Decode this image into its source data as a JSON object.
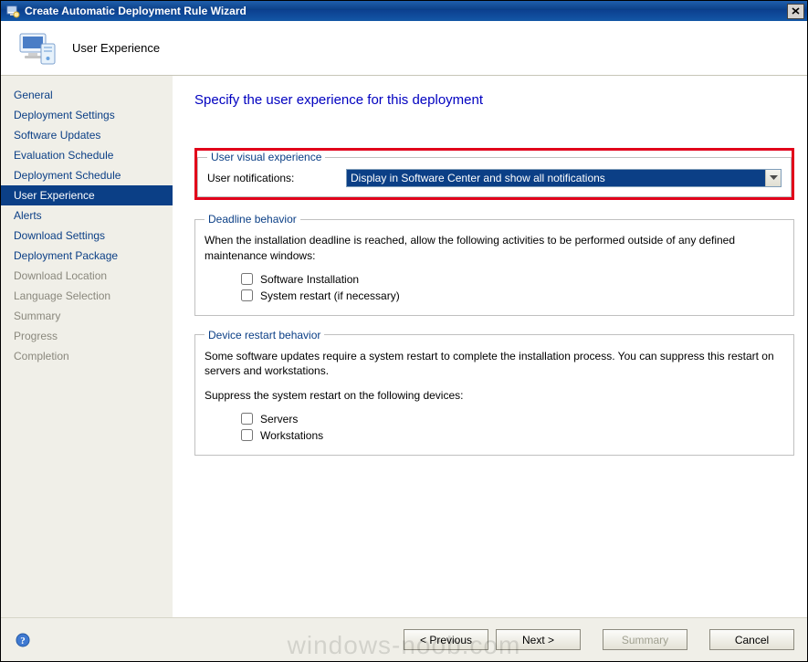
{
  "window": {
    "title": "Create Automatic Deployment Rule Wizard"
  },
  "banner": {
    "title": "User Experience"
  },
  "sidebar": {
    "items": [
      {
        "label": "General",
        "state": ""
      },
      {
        "label": "Deployment Settings",
        "state": ""
      },
      {
        "label": "Software Updates",
        "state": ""
      },
      {
        "label": "Evaluation Schedule",
        "state": ""
      },
      {
        "label": "Deployment Schedule",
        "state": ""
      },
      {
        "label": "User Experience",
        "state": "selected"
      },
      {
        "label": "Alerts",
        "state": ""
      },
      {
        "label": "Download Settings",
        "state": ""
      },
      {
        "label": "Deployment Package",
        "state": ""
      },
      {
        "label": "Download Location",
        "state": "disabled"
      },
      {
        "label": "Language Selection",
        "state": "disabled"
      },
      {
        "label": "Summary",
        "state": "disabled"
      },
      {
        "label": "Progress",
        "state": "disabled"
      },
      {
        "label": "Completion",
        "state": "disabled"
      }
    ]
  },
  "page": {
    "heading": "Specify the user experience for this deployment",
    "visual": {
      "legend": "User visual experience",
      "notifications_label": "User notifications:",
      "notifications_value": "Display in Software Center and show all notifications"
    },
    "deadline": {
      "legend": "Deadline behavior",
      "description": "When the installation deadline is reached, allow the following activities to be performed outside of any defined maintenance windows:",
      "check_install": "Software Installation",
      "check_restart": "System restart (if necessary)"
    },
    "restart": {
      "legend": "Device restart behavior",
      "description": "Some software updates require a system restart to complete the installation process.  You can suppress this restart on servers and workstations.",
      "suppress_label": "Suppress the system restart on the following devices:",
      "check_servers": "Servers",
      "check_workstations": "Workstations"
    }
  },
  "footer": {
    "previous": "< Previous",
    "next": "Next >",
    "summary": "Summary",
    "cancel": "Cancel"
  },
  "watermark": "windows-noob.com"
}
